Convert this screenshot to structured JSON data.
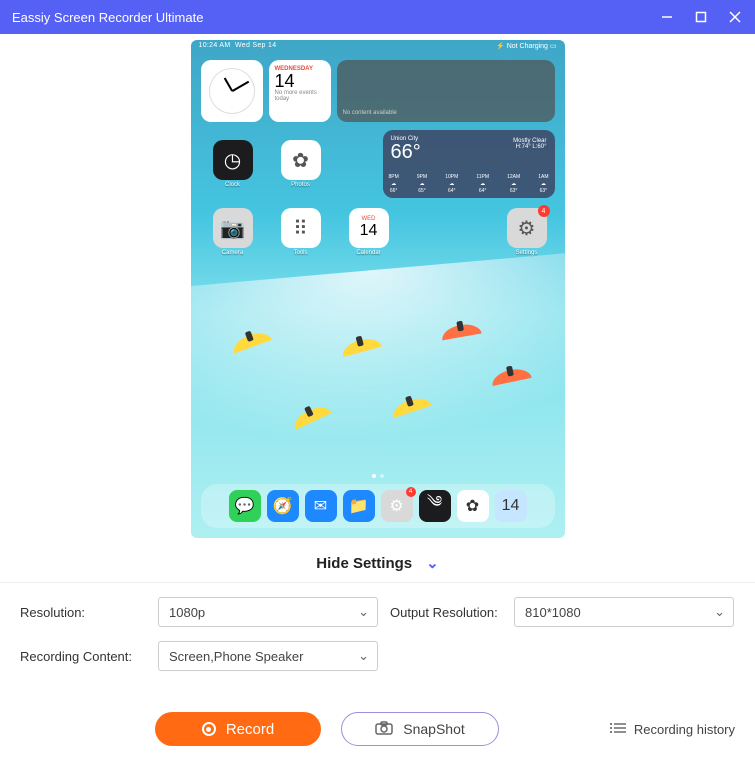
{
  "titlebar": {
    "title": "Eassiy Screen Recorder Ultimate"
  },
  "ipad": {
    "status": {
      "time": "10:24 AM",
      "date": "Wed Sep 14",
      "battery": "Not Charging"
    },
    "widgets": {
      "calendar": {
        "day": "WEDNESDAY",
        "num": "14",
        "sub": "No more events today"
      },
      "placeholder": "No content available",
      "weather": {
        "city": "Union City",
        "temp": "66°",
        "cond": "Mostly Clear",
        "range": "H:74° L:60°",
        "hourly": [
          {
            "h": "8PM",
            "t": "66°"
          },
          {
            "h": "9PM",
            "t": "65°"
          },
          {
            "h": "10PM",
            "t": "64°"
          },
          {
            "h": "11PM",
            "t": "64°"
          },
          {
            "h": "12AM",
            "t": "63°"
          },
          {
            "h": "1AM",
            "t": "63°"
          }
        ]
      }
    },
    "apps_r1": [
      {
        "name": "Clock",
        "bg": "#1c1c1e",
        "glyph": "◷"
      },
      {
        "name": "Photos",
        "bg": "#ffffff",
        "glyph": "✿"
      }
    ],
    "apps_r2": [
      {
        "name": "Camera",
        "bg": "#d9d9d9",
        "glyph": "📷"
      },
      {
        "name": "Tools",
        "bg": "#ffffff",
        "glyph": "⠿"
      },
      {
        "name": "Calendar",
        "bg": "#ffffff",
        "day": "WED",
        "num": "14"
      }
    ],
    "apps_r2_right": [
      {
        "name": "Settings",
        "bg": "#d9d9d9",
        "glyph": "⚙",
        "badge": "4"
      }
    ],
    "dock": [
      {
        "name": "Messages",
        "bg": "#30d158",
        "glyph": "💬"
      },
      {
        "name": "Safari",
        "bg": "#1e88ff",
        "glyph": "🧭"
      },
      {
        "name": "Mail",
        "bg": "#1e88ff",
        "glyph": "✉"
      },
      {
        "name": "Files",
        "bg": "#1e88ff",
        "glyph": "📁"
      },
      {
        "name": "AppStore",
        "bg": "#d9d9d9",
        "glyph": "⚙",
        "badge": "4"
      },
      {
        "name": "Dark",
        "bg": "#1c1c1e",
        "glyph": "༄"
      },
      {
        "name": "Photos",
        "bg": "#ffffff",
        "glyph": "✿"
      },
      {
        "name": "CalSmall",
        "bg": "#c6e6ff",
        "glyph": "14"
      }
    ]
  },
  "toggle": {
    "label": "Hide Settings"
  },
  "settings": {
    "resolution_label": "Resolution:",
    "resolution_value": "1080p",
    "output_label": "Output Resolution:",
    "output_value": "810*1080",
    "content_label": "Recording Content:",
    "content_value": "Screen,Phone Speaker"
  },
  "actions": {
    "record": "Record",
    "snapshot": "SnapShot",
    "history": "Recording history"
  }
}
